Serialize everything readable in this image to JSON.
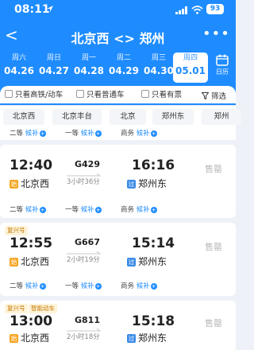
{
  "status_bar": {
    "time": "08:11",
    "battery": "93"
  },
  "nav": {
    "back": "<",
    "title": "北京西 <> 郑州",
    "more": "•••"
  },
  "dates": [
    {
      "weekday": "周六",
      "date": "04.26"
    },
    {
      "weekday": "周日",
      "date": "04.27"
    },
    {
      "weekday": "周一",
      "date": "04.28"
    },
    {
      "weekday": "周二",
      "date": "04.29"
    },
    {
      "weekday": "周三",
      "date": "04.30"
    },
    {
      "weekday": "周四",
      "date": "05.01",
      "active": true
    }
  ],
  "calendar_label": "日历",
  "filters": {
    "high_speed": "只看高铁/动车",
    "normal": "只看普通车",
    "has_ticket": "只看有票",
    "filter": "筛选"
  },
  "stations": [
    "北京西",
    "北京丰台",
    "北京",
    "郑州东",
    "郑州"
  ],
  "seat_labels": {
    "second": "二等",
    "first": "一等",
    "business": "商务",
    "waitlist": "候补"
  },
  "trains": [
    {
      "dep_time": "12:40",
      "dep_station": "北京西",
      "train_no": "G429",
      "duration": "3小时36分",
      "arr_time": "16:16",
      "arr_station": "郑州东",
      "status": "售罄"
    },
    {
      "tag": "复兴号",
      "dep_time": "12:55",
      "dep_station": "北京西",
      "train_no": "G667",
      "duration": "2小时19分",
      "arr_time": "15:14",
      "arr_station": "郑州东",
      "status": "售罄"
    },
    {
      "tag": "复兴号",
      "tag2": "智能动车",
      "dep_time": "13:00",
      "dep_station": "北京西",
      "train_no": "G811",
      "duration": "2小时18分",
      "arr_time": "15:18",
      "arr_station": "郑州东",
      "status": "售罄"
    }
  ],
  "station_badges": {
    "start": "始",
    "pass": "过"
  }
}
